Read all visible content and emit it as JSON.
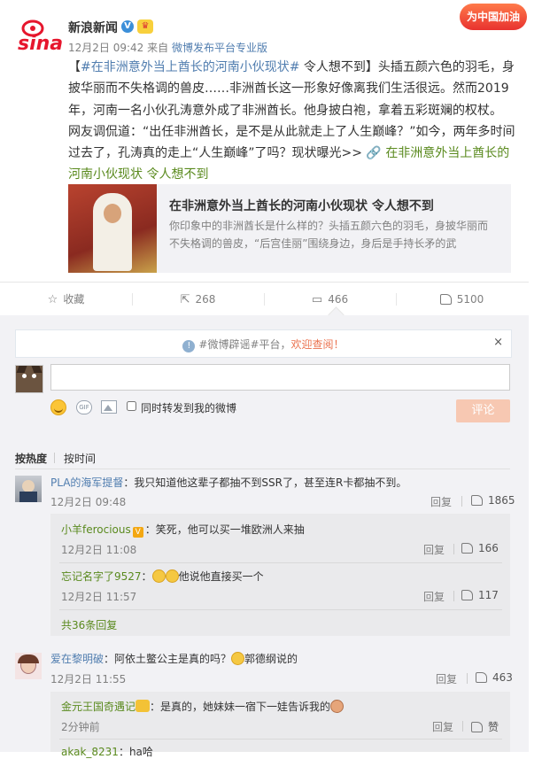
{
  "post": {
    "author": "新浪新闻",
    "verified_glyph": "V",
    "fan_badge_glyph": "♛",
    "logo_text": "sina",
    "time": "12月2日 09:42",
    "from_label": "来自",
    "source": "微博发布平台专业版",
    "promo_label": "为中国加油",
    "body_line1_prefix": "【",
    "topic": "#在非洲意外当上酋长的河南小伙现状#",
    "body_line1_suffix": " 令人想不到】头插五颜六色的羽毛，身",
    "body_line2": "披华丽而不失格调的兽皮……非洲酋长这一形象好像离我们生活很远。然而2019",
    "body_line3": "年，河南一名小伙孔涛意外成了非洲酋长。他身披白袍，拿着五彩斑斓的权杖。",
    "body_line4": "网友调侃道：“出任非洲酋长，是不是从此就走上了人生巅峰？”如今，两年多时间",
    "body_line5_prefix": "过去了，孔涛真的走上“人生巅峰”了吗？现状曝光>> ",
    "link_icon": "🔗",
    "link_text_1": "在非洲意外当上酋长的",
    "link_text_2": "河南小伙现状 令人想不到"
  },
  "card": {
    "title": "在非洲意外当上酋长的河南小伙现状 令人想不到",
    "desc_line1": "你印象中的非洲酋长是什么样的？头插五颜六色的羽毛，身披华丽而",
    "desc_line2": "不失格调的兽皮，“后宫佳丽”围绕身边，身后是手持长矛的武"
  },
  "actions": {
    "favorite_label": "收藏",
    "favorite_icon": "☆",
    "repost_count": "268",
    "repost_icon": "⇱",
    "comment_count": "466",
    "comment_icon": "▭",
    "like_count": "5100"
  },
  "notice": {
    "info_glyph": "!",
    "prefix": "#微博辟谣#平台，",
    "link": "欢迎查阅！",
    "close_glyph": "×"
  },
  "composer": {
    "input_value": "",
    "gif_label": "GIF",
    "forward_label": "同时转发到我的微博",
    "submit_label": "评论"
  },
  "sort": {
    "hot_label": "按热度",
    "time_label": "按时间"
  },
  "reply_label": "回复",
  "comments": [
    {
      "user": "PLA的海军提督",
      "text": "：我只知道他这辈子都抽不到SSR了，甚至连R卡都抽不到。",
      "time": "12月2日 09:48",
      "likes": "1865"
    },
    {
      "user": "爱在黎明破",
      "text": "：阿依土鳖公主是真的吗？",
      "text_suffix": "郭德纲说的",
      "time": "12月2日 11:55",
      "likes": "463"
    }
  ],
  "replies": [
    {
      "user": "小羊ferocious",
      "text": "：笑死，他可以买一堆欧洲人来抽",
      "time": "12月2日 11:08",
      "likes": "166"
    },
    {
      "user": "忘记名字了9527",
      "text": "他说他直接买一个",
      "time": "12月2日 11:57",
      "likes": "117"
    },
    {
      "user": "金元王国奇遇记",
      "text": "：是真的，她妹妹一宿下一娃告诉我的",
      "time": "2分钟前",
      "likes": "赞"
    },
    {
      "user": "akak_8231",
      "text": "：ha哈"
    }
  ],
  "more_replies": "共36条回复"
}
